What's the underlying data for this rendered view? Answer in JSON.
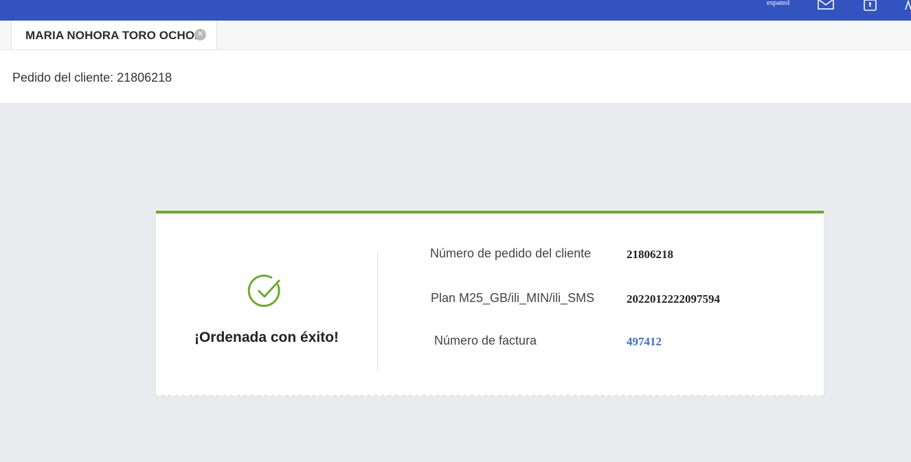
{
  "topbar": {
    "language_label": "espanol",
    "icons": [
      "mail-icon",
      "lock-icon",
      "user-icon"
    ],
    "color": "#3353bf"
  },
  "tab": {
    "label": "MARIA NOHORA TORO OCHOA",
    "close_icon": "close-icon"
  },
  "order_header": {
    "text": "Pedido del cliente: 21806218"
  },
  "result": {
    "status_icon": "check-circle-icon",
    "status_text": "¡Ordenada con éxito!",
    "accent_color": "#6aab28",
    "fields": [
      {
        "label": "Número de pedido del cliente",
        "value": "21806218"
      },
      {
        "label": "Plan M25_GB/ili_MIN/ili_SMS",
        "value": "2022012222097594"
      },
      {
        "label": "Número de factura",
        "value": "497412",
        "link": true
      }
    ],
    "link_color": "#3b6ed6"
  }
}
